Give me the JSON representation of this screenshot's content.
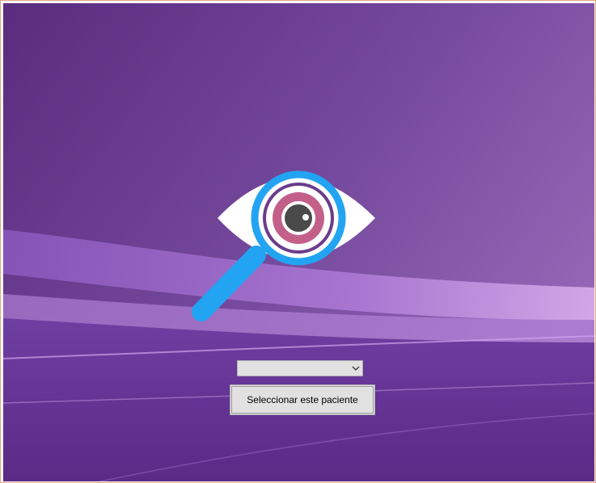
{
  "colors": {
    "background_dark": "#5c2f7f",
    "background_light": "#8e5fb0",
    "wave_highlight": "#d7a8ef",
    "eye_white": "#ffffff",
    "lens_blue": "#22a4f2",
    "iris_pink": "#c3608a",
    "iris_ring": "#6b3c8b",
    "pupil": "#4a4a4a",
    "window_border": "#e8a57f"
  },
  "logo": {
    "icon": "eye-magnifier-icon"
  },
  "patient_selector": {
    "selected_value": "",
    "arrow_icon": "chevron-down-icon"
  },
  "actions": {
    "select_patient_label": "Seleccionar este paciente"
  }
}
